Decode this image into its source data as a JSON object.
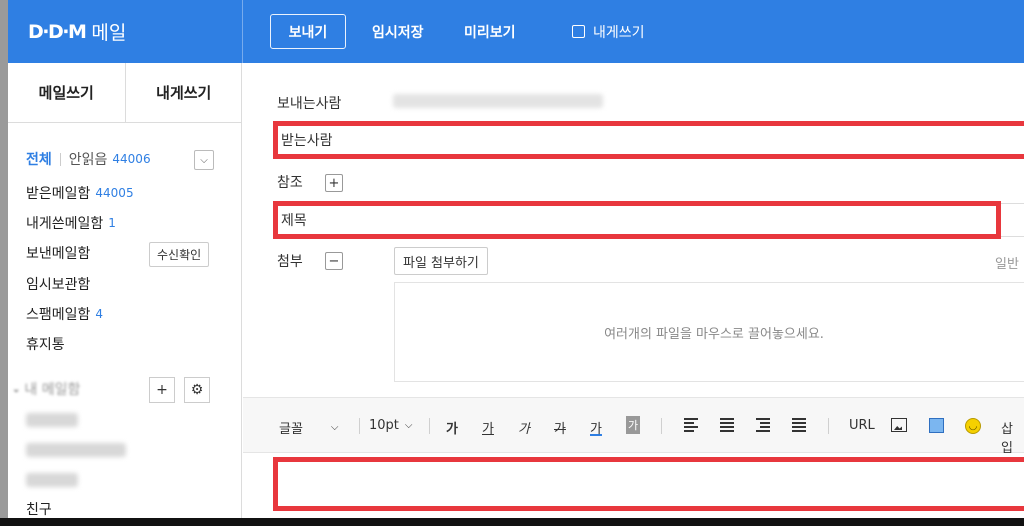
{
  "app": {
    "logo": "D∙D∙M",
    "title": "메일"
  },
  "top_actions": {
    "send": "보내기",
    "save": "임시저장",
    "preview": "미리보기",
    "self_write": "내게쓰기"
  },
  "sidebar": {
    "tabs": [
      "메일쓰기",
      "내게쓰기"
    ],
    "filter": {
      "all": "전체",
      "unread": "안읽음",
      "unread_count": "44006"
    },
    "mailboxes": [
      {
        "label": "받은메일함",
        "count": "44005"
      },
      {
        "label": "내게쓴메일함",
        "count": "1"
      },
      {
        "label": "보낸메일함",
        "count": ""
      },
      {
        "label": "임시보관함",
        "count": ""
      },
      {
        "label": "스팸메일함",
        "count": "4"
      },
      {
        "label": "휴지통",
        "count": ""
      }
    ],
    "read_receipt_button": "수신확인",
    "my_mailbox_header": "내 메일함",
    "last_item": "친구"
  },
  "compose": {
    "from_label": "보내는사람",
    "to_label": "받는사람",
    "cc_label": "참조",
    "subject_label": "제목",
    "attach_label": "첨부",
    "attach_button": "파일 첨부하기",
    "attach_mode": "일반",
    "dropzone_text": "여러개의 파일을 마우스로 끌어놓으세요."
  },
  "toolbar": {
    "font": "글꼴",
    "size": "10pt",
    "bold": "가",
    "underline": "가",
    "italic": "가",
    "strike": "가",
    "font_color": "가",
    "bg_color": "가",
    "url": "URL",
    "insert": "삽입"
  },
  "colors": {
    "brand": "#2f7fe3",
    "highlight": "#e8373d"
  }
}
